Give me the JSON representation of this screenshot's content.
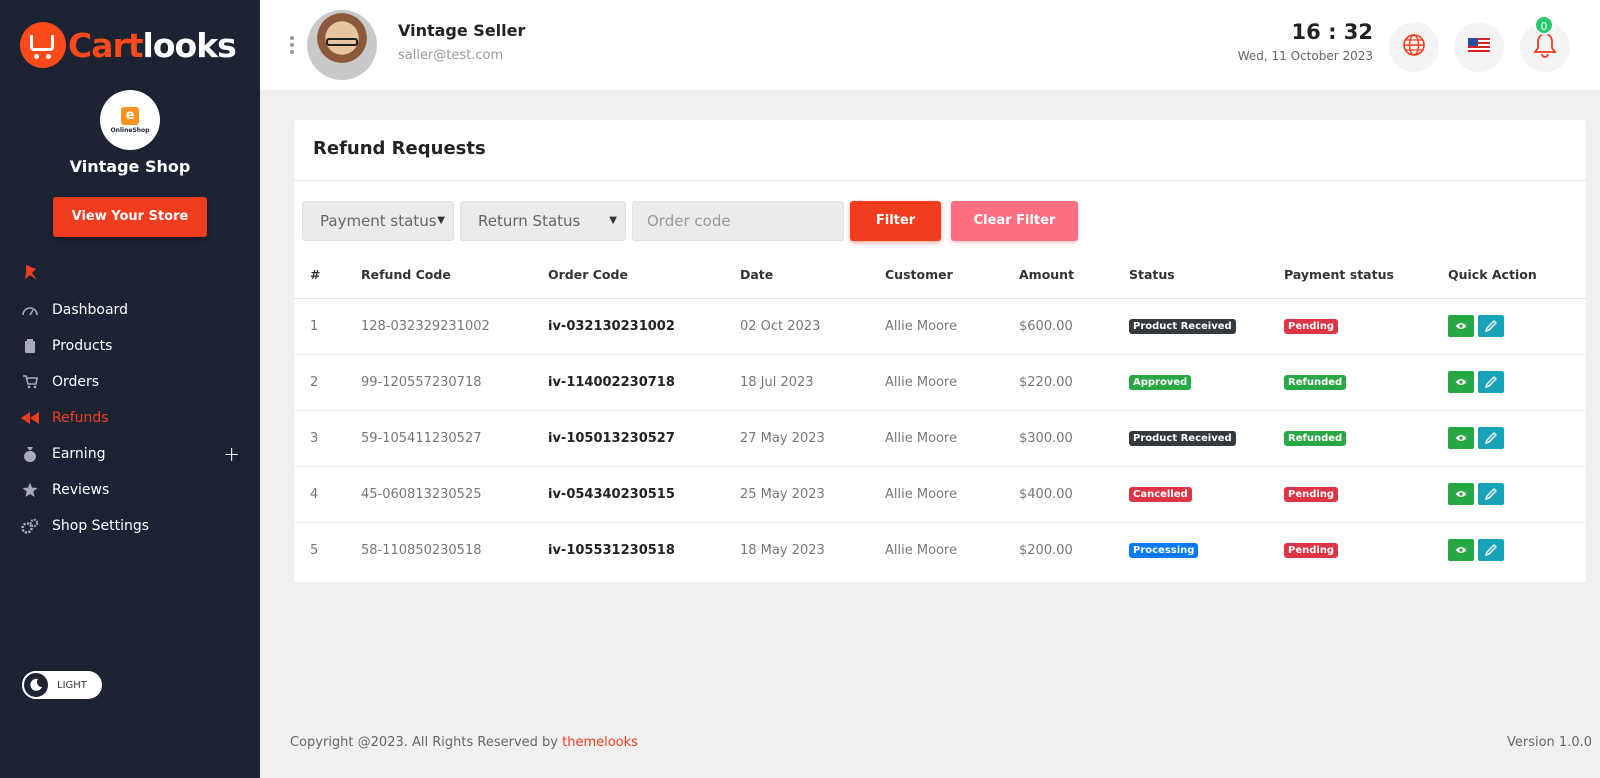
{
  "brand": {
    "part1": "Cart",
    "part2": "looks"
  },
  "shop": {
    "logo_text": "OnlineShop",
    "logo_letter": "e",
    "name": "Vintage Shop",
    "view_store_label": "View Your Store"
  },
  "nav": {
    "items": [
      {
        "label": "Dashboard",
        "icon": "speedometer-icon"
      },
      {
        "label": "Products",
        "icon": "box-icon"
      },
      {
        "label": "Orders",
        "icon": "cart-icon"
      },
      {
        "label": "Refunds",
        "icon": "rewind-icon",
        "active": true
      },
      {
        "label": "Earning",
        "icon": "money-bag-icon",
        "expandable": true
      },
      {
        "label": "Reviews",
        "icon": "star-icon"
      },
      {
        "label": "Shop Settings",
        "icon": "gears-icon"
      }
    ],
    "expand_symbol": "+"
  },
  "theme": {
    "label": "LIGHT"
  },
  "header": {
    "seller_name": "Vintage Seller",
    "seller_email": "saller@test.com",
    "time": "16 : 32",
    "date": "Wed, 11 October 2023",
    "notification_count": "0"
  },
  "page": {
    "title": "Refund Requests"
  },
  "filters": {
    "payment_status": "Payment status",
    "return_status": "Return Status",
    "order_code_placeholder": "Order code",
    "filter_label": "Filter",
    "clear_label": "Clear Filter"
  },
  "table": {
    "headers": [
      "#",
      "Refund Code",
      "Order Code",
      "Date",
      "Customer",
      "Amount",
      "Status",
      "Payment status",
      "Quick Action"
    ],
    "rows": [
      {
        "num": "1",
        "refund_code": "128-032329231002",
        "order_code": "iv-032130231002",
        "date": "02 Oct 2023",
        "customer": "Allie Moore",
        "amount": "$600.00",
        "status": "Product Received",
        "status_color": "#343a40",
        "payment": "Pending",
        "payment_color": "#dc3545"
      },
      {
        "num": "2",
        "refund_code": "99-120557230718",
        "order_code": "iv-114002230718",
        "date": "18 Jul 2023",
        "customer": "Allie Moore",
        "amount": "$220.00",
        "status": "Approved",
        "status_color": "#28a745",
        "payment": "Refunded",
        "payment_color": "#28a745"
      },
      {
        "num": "3",
        "refund_code": "59-105411230527",
        "order_code": "iv-105013230527",
        "date": "27 May 2023",
        "customer": "Allie Moore",
        "amount": "$300.00",
        "status": "Product Received",
        "status_color": "#343a40",
        "payment": "Refunded",
        "payment_color": "#28a745"
      },
      {
        "num": "4",
        "refund_code": "45-060813230525",
        "order_code": "iv-054340230515",
        "date": "25 May 2023",
        "customer": "Allie Moore",
        "amount": "$400.00",
        "status": "Cancelled",
        "status_color": "#dc3545",
        "payment": "Pending",
        "payment_color": "#dc3545"
      },
      {
        "num": "5",
        "refund_code": "58-110850230518",
        "order_code": "iv-105531230518",
        "date": "18 May 2023",
        "customer": "Allie Moore",
        "amount": "$200.00",
        "status": "Processing",
        "status_color": "#007bff",
        "payment": "Pending",
        "payment_color": "#dc3545"
      }
    ]
  },
  "colors": {
    "accent": "#f23c1f",
    "sidebar": "#1c2434",
    "view_btn": "#28a745",
    "edit_btn": "#17a2b8"
  },
  "footer": {
    "copyright": "Copyright @2023. All Rights Reserved by ",
    "link": "themelooks",
    "version": "Version 1.0.0"
  }
}
